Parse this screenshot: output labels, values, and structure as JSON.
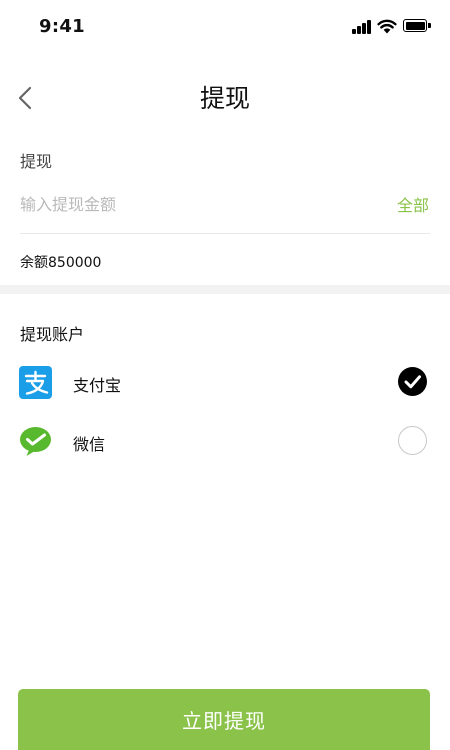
{
  "status_bar": {
    "time": "9:41"
  },
  "nav": {
    "title": "提现",
    "back_icon": "chevron-left-icon"
  },
  "withdraw": {
    "label": "提现",
    "input_placeholder": "输入提现金额",
    "input_value": "",
    "all_label": "全部",
    "balance": "余额850000"
  },
  "accounts": {
    "label": "提现账户",
    "items": [
      {
        "name": "支付宝",
        "icon": "alipay-icon",
        "selected": true
      },
      {
        "name": "微信",
        "icon": "wechat-icon",
        "selected": false
      }
    ]
  },
  "submit": {
    "label": "立即提现"
  },
  "colors": {
    "accent": "#8bc34a",
    "alipay": "#1a9ee8",
    "wechat": "#59b92e",
    "section_gap": "#f2f2f2"
  }
}
